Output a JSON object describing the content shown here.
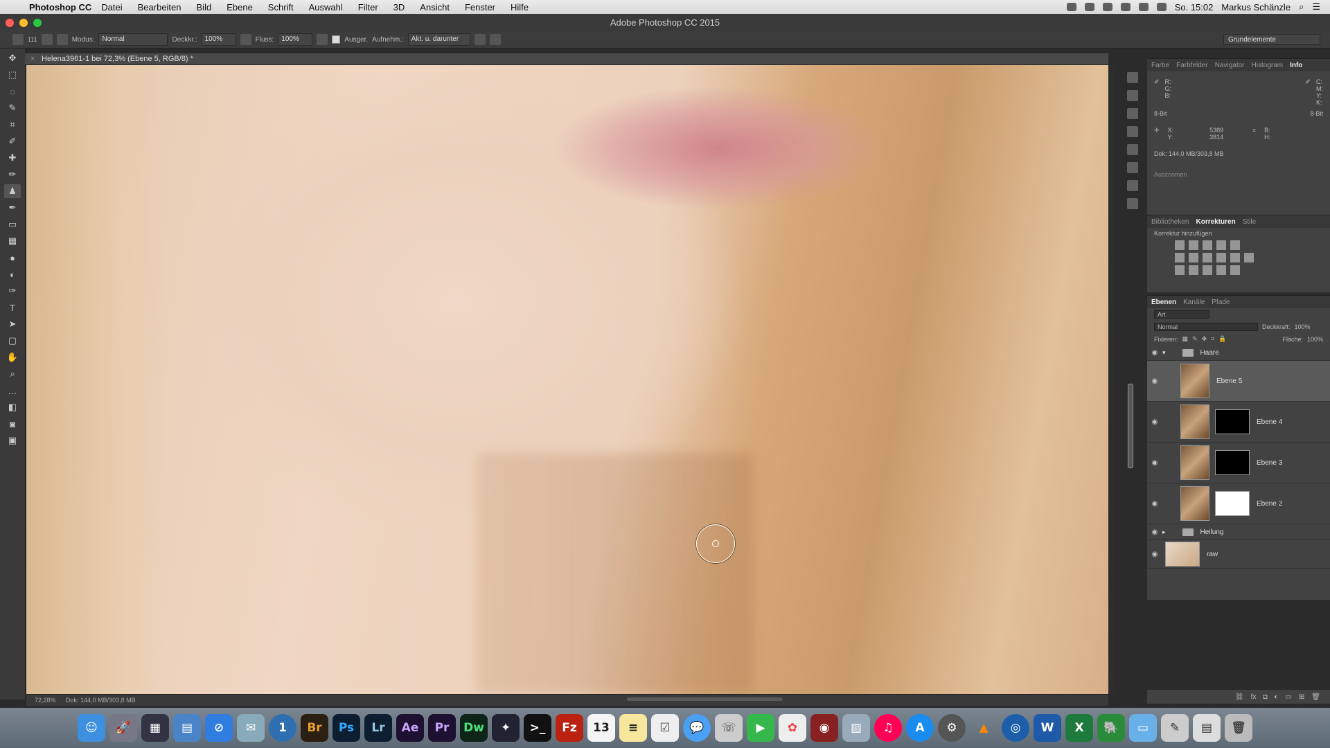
{
  "menubar": {
    "app_name": "Photoshop CC",
    "items": [
      "Datei",
      "Bearbeiten",
      "Bild",
      "Ebene",
      "Schrift",
      "Auswahl",
      "Filter",
      "3D",
      "Ansicht",
      "Fenster",
      "Hilfe"
    ],
    "clock": "So. 15:02",
    "user": "Markus Schänzle"
  },
  "titlebar": {
    "title": "Adobe Photoshop CC 2015"
  },
  "optionsbar": {
    "brush_size": "111",
    "mode_label": "Modus:",
    "mode_value": "Normal",
    "opacity_label": "Deckkr.:",
    "opacity_value": "100%",
    "flow_label": "Fluss:",
    "flow_value": "100%",
    "aligned_label": "Ausger.",
    "sample_label": "Aufnehm.:",
    "sample_value": "Akt. u. darunter",
    "workspace": "Grundelemente"
  },
  "document": {
    "tab_title": "Helena3961-1 bei 72,3% (Ebene 5, RGB/8) *",
    "zoom": "72,28%",
    "doc_size": "Dok: 144,0 MB/303,8 MB"
  },
  "info_panel": {
    "tabs": [
      "Farbe",
      "Farbfelder",
      "Navigator",
      "Histogram",
      "Info"
    ],
    "active_tab": "Info",
    "rgb_labels": "R:\nG:\nB:",
    "bit_left": "8-Bit",
    "bit_right": "8-Bit",
    "x_label": "X:",
    "y_label": "Y:",
    "x_value": "5389",
    "y_value": "3814",
    "doc_size": "Dok: 144,0 MB/303,8 MB",
    "hint": "Auszoomen"
  },
  "adjustments_panel": {
    "tabs": [
      "Bibliotheken",
      "Korrekturen",
      "Stile"
    ],
    "active_tab": "Korrekturen",
    "subtitle": "Korrektur hinzufügen"
  },
  "layers_panel": {
    "tabs": [
      "Ebenen",
      "Kanäle",
      "Pfade"
    ],
    "active_tab": "Ebenen",
    "filter_label": "Art",
    "blend_mode": "Normal",
    "opacity_label": "Deckkraft:",
    "opacity_value": "100%",
    "lock_label": "Fixieren:",
    "fill_label": "Fläche:",
    "fill_value": "100%",
    "layers": [
      {
        "name": "Haare",
        "type": "group"
      },
      {
        "name": "Ebene 5",
        "type": "layer",
        "selected": true
      },
      {
        "name": "Ebene 4",
        "type": "layer-mask"
      },
      {
        "name": "Ebene 3",
        "type": "layer-mask"
      },
      {
        "name": "Ebene 2",
        "type": "layer-mask-white"
      },
      {
        "name": "Heilung",
        "type": "group"
      },
      {
        "name": "raw",
        "type": "layer"
      }
    ]
  },
  "dock": {
    "apps": [
      "Finder",
      "Launchpad",
      "Mission Control",
      "Preview",
      "Safari",
      "Mail",
      "1Password",
      "Br",
      "Ps",
      "Lr",
      "Ae",
      "Pr",
      "Dw",
      "Motion",
      "Terminal",
      "FileZilla",
      "Calendar",
      "Notes",
      "Reminders",
      "Messages",
      "Contacts",
      "FaceTime",
      "Photos",
      "PhotoBooth",
      "Preview2",
      "iTunes",
      "App Store",
      "System Preferences",
      "VLC",
      "Network",
      "W",
      "X",
      "Evernote",
      "Folder",
      "Brushes",
      "Downloads",
      "Trash"
    ]
  }
}
